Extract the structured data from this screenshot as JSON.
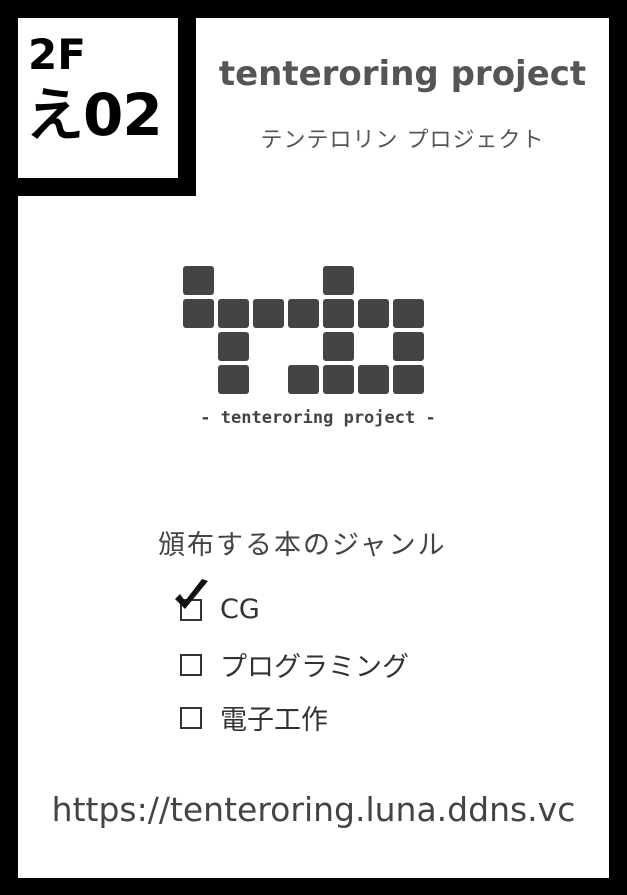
{
  "booth": {
    "floor": "2F",
    "space": "え02"
  },
  "circle": {
    "name": "tenteroring project",
    "kana": "テンテロリン プロジェクト"
  },
  "logo": {
    "subtitle": "- tenteroring project -"
  },
  "genres": {
    "title": "頒布する本のジャンル",
    "items": [
      {
        "label": "CG",
        "checked": true
      },
      {
        "label": "プログラミング",
        "checked": false
      },
      {
        "label": "電子工作",
        "checked": false
      }
    ]
  },
  "url": "https://tenteroring.luna.ddns.vc",
  "colors": {
    "frame": "#000000",
    "logo": "#444444",
    "text": "#555555"
  }
}
